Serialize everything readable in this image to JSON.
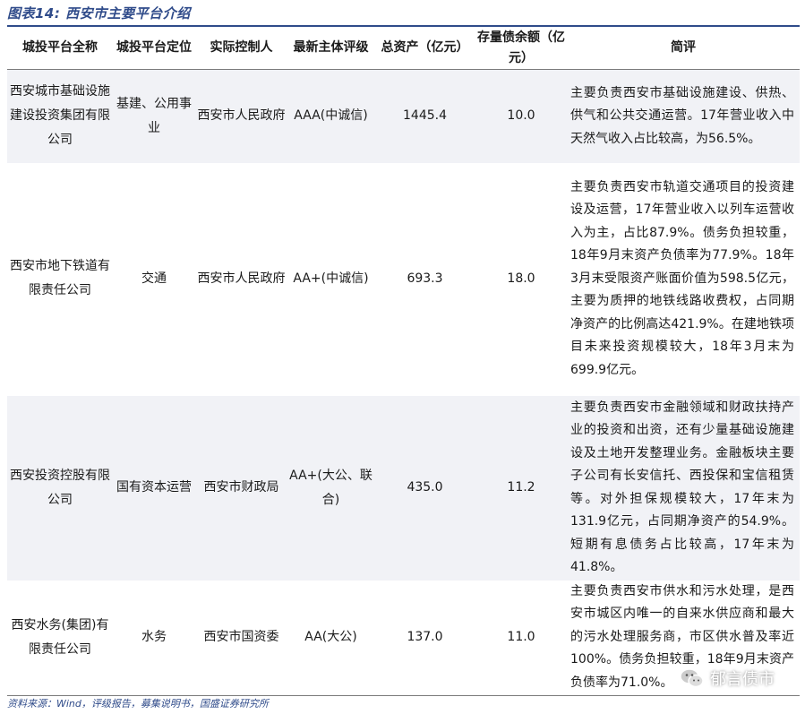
{
  "title": "图表14: 西安市主要平台介绍",
  "table": {
    "headers": [
      "城投平台全称",
      "城投平台定位",
      "实际控制人",
      "最新主体评级",
      "总资产（亿元）",
      "存量债余额（亿元）",
      "简评"
    ],
    "rows": [
      {
        "name": "西安城市基础设施建设投资集团有限公司",
        "position": "基建、公用事业",
        "controller": "西安市人民政府",
        "rating": "AAA(中诚信)",
        "total_assets": "1445.4",
        "bond_balance": "10.0",
        "comment": "主要负责西安市基础设施建设、供热、供气和公共交通运营。17年营业收入中天然气收入占比较高，为56.5%。"
      },
      {
        "name": "西安市地下铁道有限责任公司",
        "position": "交通",
        "controller": "西安市人民政府",
        "rating": "AA+(中诚信)",
        "total_assets": "693.3",
        "bond_balance": "18.0",
        "comment": "主要负责西安市轨道交通项目的投资建设及运营，17年营业收入以列车运营收入为主，占比87.9%。债务负担较重，18年9月末资产负债率为77.9%。18年3月末受限资产账面价值为598.5亿元，主要为质押的地铁线路收费权，占同期净资产的比例高达421.9%。在建地铁项目未来投资规模较大，18年3月末为699.9亿元。"
      },
      {
        "name": "西安投资控股有限公司",
        "position": "国有资本运营",
        "controller": "西安市财政局",
        "rating": "AA+(大公、联合)",
        "total_assets": "435.0",
        "bond_balance": "11.2",
        "comment": "主要负责西安市金融领域和财政扶持产业的投资和出资，还有少量基础设施建设及土地开发整理业务。金融板块主要子公司有长安信托、西投保和宝信租赁等。对外担保规模较大，17年末为131.9亿元，占同期净资产的54.9%。短期有息债务占比较高，17年末为41.8%。"
      },
      {
        "name": "西安水务(集团)有限责任公司",
        "position": "水务",
        "controller": "西安市国资委",
        "rating": "AA(大公)",
        "total_assets": "137.0",
        "bond_balance": "11.0",
        "comment": "主要负责西安市供水和污水处理，是西安市城区内唯一的自来水供应商和最大的污水处理服务商，市区供水普及率近100%。债务负担较重，18年9月末资产负债率为71.0%。"
      }
    ]
  },
  "source": "资料来源：Wind，评级报告，募集说明书，国盛证券研究所",
  "watermark": {
    "text": "郁言债市",
    "icon": "wechat-icon"
  }
}
